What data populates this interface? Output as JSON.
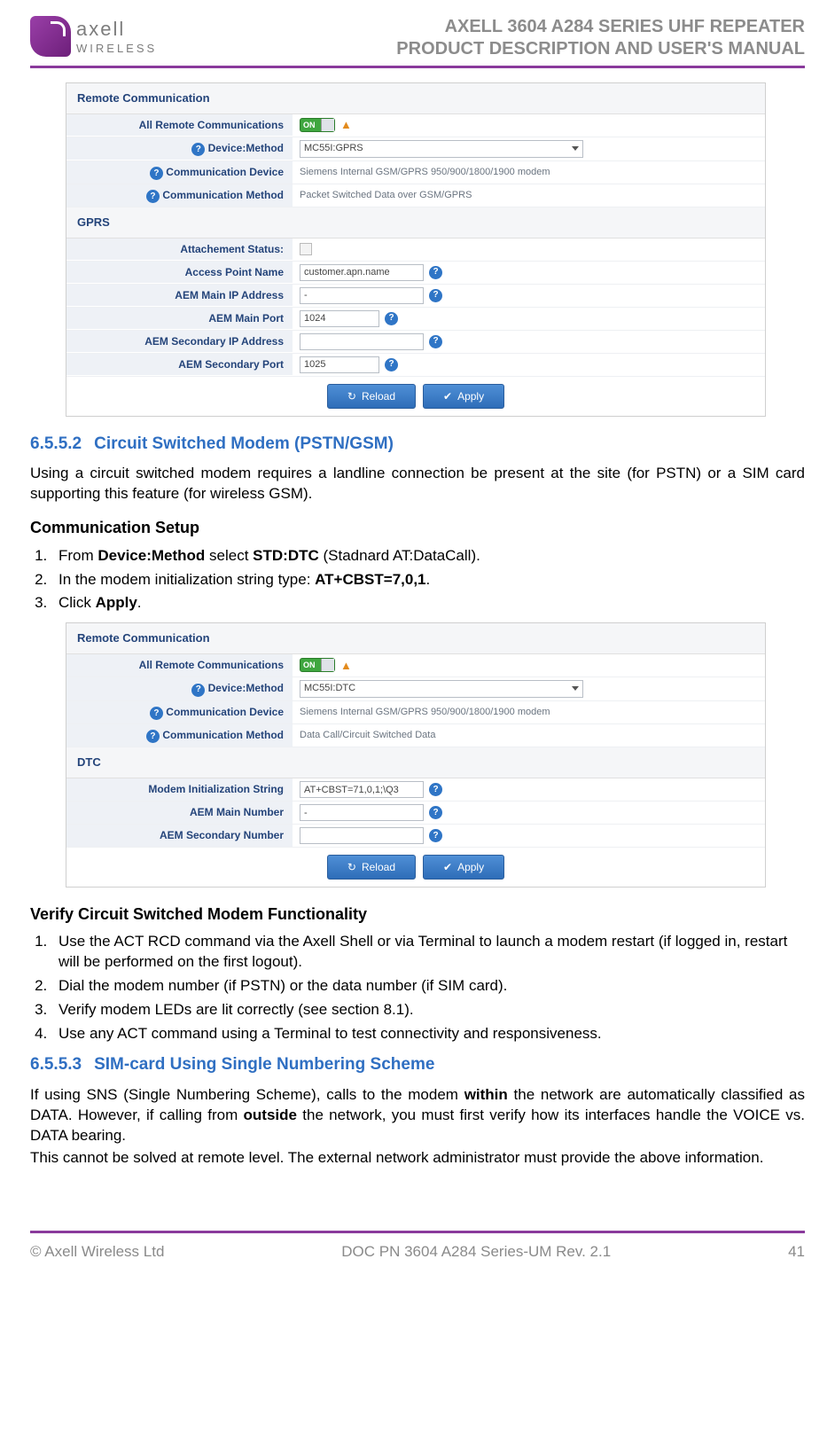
{
  "header": {
    "logo_top": "axell",
    "logo_bottom": "WIRELESS",
    "title_line1": "AXELL 3604 A284 SERIES UHF REPEATER",
    "title_line2": "PRODUCT DESCRIPTION AND USER'S MANUAL"
  },
  "screenshot1": {
    "remote_title": "Remote Communication",
    "labels": {
      "all_remote": "All Remote Communications",
      "device_method": "Device:Method",
      "comm_device": "Communication Device",
      "comm_method": "Communication Method"
    },
    "values": {
      "toggle": "ON",
      "device_method": "MC55I:GPRS",
      "comm_device": "Siemens Internal GSM/GPRS 950/900/1800/1900 modem",
      "comm_method": "Packet Switched Data over GSM/GPRS"
    },
    "gprs_title": "GPRS",
    "gprs_labels": {
      "attach": "Attachement Status:",
      "apn": "Access Point Name",
      "main_ip": "AEM Main IP Address",
      "main_port": "AEM Main Port",
      "sec_ip": "AEM Secondary IP Address",
      "sec_port": "AEM Secondary Port"
    },
    "gprs_values": {
      "apn": "customer.apn.name",
      "main_ip": "-",
      "main_port": "1024",
      "sec_ip": "",
      "sec_port": "1025"
    },
    "buttons": {
      "reload": "Reload",
      "apply": "Apply"
    }
  },
  "section1": {
    "num": "6.5.5.2",
    "title": "Circuit Switched Modem (PSTN/GSM)",
    "para": "Using a circuit switched modem requires a landline connection be present at the site (for PSTN) or a SIM card supporting this feature (for wireless GSM).",
    "sub": "Communication Setup",
    "li1_a": "From ",
    "li1_b": "Device:Method",
    "li1_c": " select ",
    "li1_d": "STD:DTC",
    "li1_e": " (Stadnard AT:DataCall).",
    "li2_a": "In the modem initialization string type: ",
    "li2_b": "AT+CBST=7,0,1",
    "li2_c": ".",
    "li3_a": "Click ",
    "li3_b": "Apply",
    "li3_c": "."
  },
  "screenshot2": {
    "remote_title": "Remote Communication",
    "labels": {
      "all_remote": "All Remote Communications",
      "device_method": "Device:Method",
      "comm_device": "Communication Device",
      "comm_method": "Communication Method"
    },
    "values": {
      "toggle": "ON",
      "device_method": "MC55I:DTC",
      "comm_device": "Siemens Internal GSM/GPRS 950/900/1800/1900 modem",
      "comm_method": "Data Call/Circuit Switched Data"
    },
    "dtc_title": "DTC",
    "dtc_labels": {
      "init": "Modem Initialization String",
      "main_num": "AEM Main Number",
      "sec_num": "AEM Secondary Number"
    },
    "dtc_values": {
      "init": "AT+CBST=71,0,1;\\Q3",
      "main_num": "-",
      "sec_num": ""
    },
    "buttons": {
      "reload": "Reload",
      "apply": "Apply"
    }
  },
  "verify": {
    "title": "Verify Circuit Switched Modem Functionality",
    "li1": "Use the ACT RCD command via the Axell Shell or via Terminal to launch a modem restart (if logged in, restart will be performed on the first logout).",
    "li2": "Dial the modem number (if PSTN) or the data number (if SIM card).",
    "li3": "Verify modem LEDs are lit correctly (see section 8.1).",
    "li4": "Use any ACT command using a Terminal to test connectivity and responsiveness."
  },
  "section2": {
    "num": "6.5.5.3",
    "title": "SIM-card Using Single Numbering Scheme",
    "p1_a": "If using SNS (Single Numbering Scheme), calls to the modem ",
    "p1_b": "within",
    "p1_c": " the network are automatically classified as DATA. However, if calling from ",
    "p1_d": "outside",
    "p1_e": " the network, you must first verify how its interfaces handle the VOICE vs. DATA bearing.",
    "p2": "This cannot be solved at remote level. The external network administrator must provide the above information."
  },
  "footer": {
    "left": "© Axell Wireless Ltd",
    "center": "DOC PN 3604 A284 Series-UM Rev. 2.1",
    "right": "41"
  }
}
